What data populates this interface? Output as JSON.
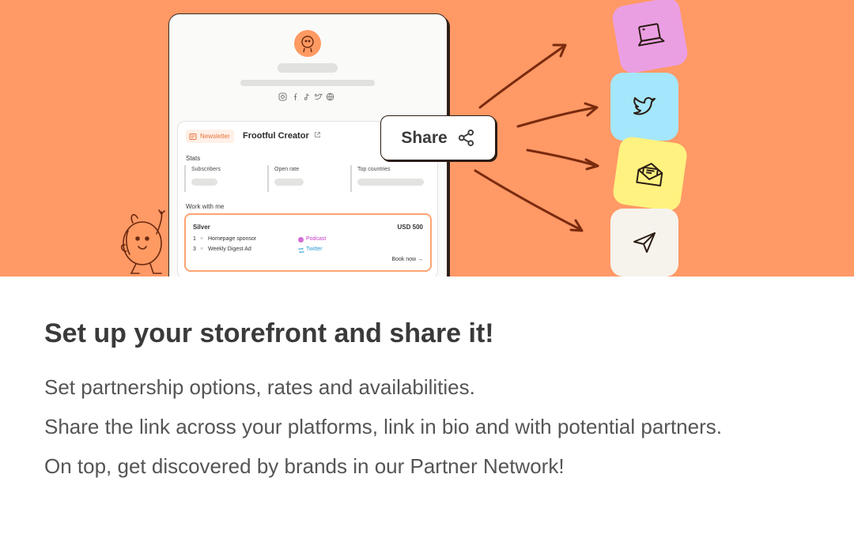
{
  "colors": {
    "hero_bg": "#ff9966",
    "accent": "#ff9a62",
    "tile_laptop": "#eb9fe3",
    "tile_twitter": "#a4e6fb",
    "tile_mail": "#fff280",
    "tile_send": "#f5f3ec",
    "podcast": "#c63cc7",
    "twitter": "#2a9fd6"
  },
  "card": {
    "tag_label": "Newsletter",
    "creator_name": "Frootful Creator",
    "social_icons": [
      "instagram-icon",
      "facebook-icon",
      "tiktok-icon",
      "twitter-icon",
      "globe-icon"
    ],
    "stats_label": "Stats",
    "stats": [
      "Subscribers",
      "Open rate",
      "Top countries"
    ],
    "work_label": "Work with me",
    "offer": {
      "tier": "Silver",
      "price": "USD 500",
      "items": [
        {
          "qty": "1",
          "sep": "×",
          "name": "Homepage sponsor",
          "channel": "Podcast"
        },
        {
          "qty": "3",
          "sep": "×",
          "name": "Weekly Digest Ad",
          "channel": "Twitter"
        }
      ],
      "cta": "Book now →"
    }
  },
  "share_button": {
    "label": "Share",
    "icon": "share-icon"
  },
  "tiles": [
    "laptop-icon",
    "twitter-icon",
    "envelope-icon",
    "send-icon"
  ],
  "content": {
    "title": "Set up your storefront and share it!",
    "lines": [
      "Set partnership options, rates and availabilities.",
      "Share the link across your platforms, link in bio and with potential partners.",
      "On top, get discovered by brands in our Partner Network!"
    ]
  }
}
